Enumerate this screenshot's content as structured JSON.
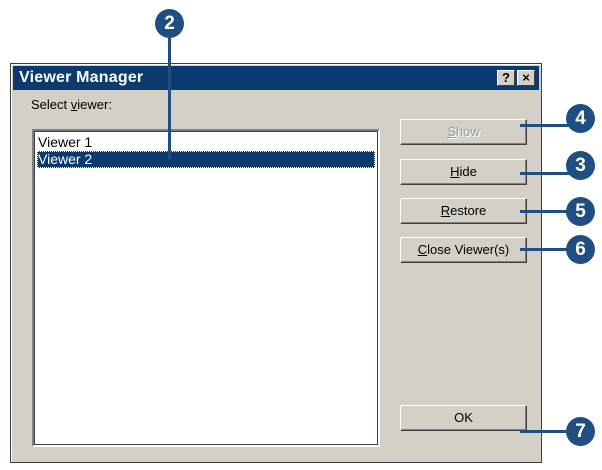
{
  "window": {
    "title": "Viewer Manager",
    "help_label": "?",
    "close_label": "×"
  },
  "select_label": {
    "before": "Select ",
    "accel": "v",
    "after": "iewer:"
  },
  "viewers": [
    {
      "label": "Viewer 1",
      "selected": false
    },
    {
      "label": "Viewer 2",
      "selected": true
    }
  ],
  "buttons": {
    "show": {
      "accel": "S",
      "rest": "how",
      "disabled": true
    },
    "hide": {
      "accel": "H",
      "rest": "ide",
      "disabled": false
    },
    "restore": {
      "accel": "R",
      "rest": "estore",
      "disabled": false
    },
    "close": {
      "accel": "C",
      "rest": "lose Viewer(s)",
      "disabled": false
    },
    "ok": {
      "label": "OK"
    }
  },
  "callouts": {
    "c2": "2",
    "c3": "3",
    "c4": "4",
    "c5": "5",
    "c6": "6",
    "c7": "7"
  },
  "colors": {
    "accent": "#1f4e82",
    "titlebar": "#0b3a6e",
    "dialog_bg": "#d4d0c8"
  }
}
